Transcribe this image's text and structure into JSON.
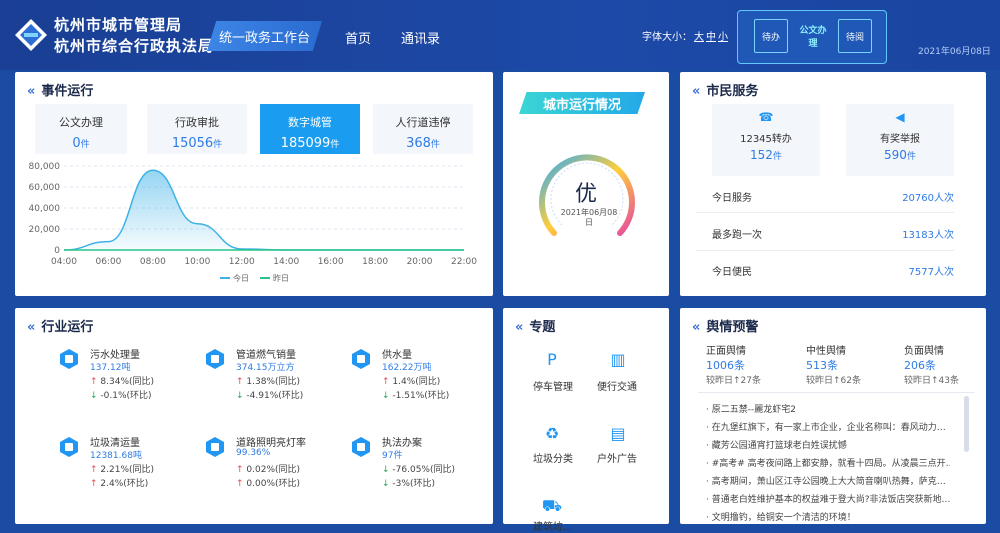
{
  "header": {
    "org_line1": "杭州市城市管理局",
    "org_line2": "杭州市综合行政执法局",
    "nav_workbench": "统一政务工作台",
    "nav_home": "首页",
    "nav_contacts": "通讯录",
    "font_label": "字体大小：",
    "font_options": [
      "大",
      "中",
      "小"
    ],
    "quick": [
      {
        "label": "待办"
      },
      {
        "label": "公文办理"
      },
      {
        "label": "待阅"
      }
    ],
    "date": "2021年06月08日"
  },
  "events": {
    "title": "事件运行",
    "stats": [
      {
        "label": "公文办理",
        "value": "0",
        "unit": "件"
      },
      {
        "label": "行政审批",
        "value": "15056",
        "unit": "件"
      },
      {
        "label": "数字城管",
        "value": "185099",
        "unit": "件"
      },
      {
        "label": "人行道违停",
        "value": "368",
        "unit": "件"
      }
    ]
  },
  "chart_data": {
    "type": "area",
    "x": [
      "04:00",
      "06:00",
      "08:00",
      "10:00",
      "12:00",
      "14:00",
      "16:00",
      "18:00",
      "20:00",
      "22:00"
    ],
    "series": [
      {
        "name": "今日",
        "values": [
          0,
          8000,
          76000,
          25000,
          1000,
          0,
          0,
          0,
          0,
          0
        ],
        "color": "#3eb2e6"
      },
      {
        "name": "昨日",
        "values": [
          0,
          0,
          0,
          0,
          0,
          0,
          0,
          0,
          0,
          0
        ],
        "color": "#27c48a"
      }
    ],
    "yticks": [
      "0",
      "20,000",
      "40,000",
      "60,000",
      "80,000"
    ],
    "ylim": [
      0,
      80000
    ],
    "grid": true,
    "legend": "bottom"
  },
  "city": {
    "title": "城市运行情况",
    "grade": "优",
    "date": "2021年06月08日"
  },
  "citizen": {
    "title": "市民服务",
    "cards": [
      {
        "label": "12345转办",
        "value": "152",
        "unit": "件"
      },
      {
        "label": "有奖举报",
        "value": "590",
        "unit": "件"
      }
    ],
    "rows": [
      {
        "label": "今日服务",
        "value": "20760人次"
      },
      {
        "label": "最多跑一次",
        "value": "13183人次"
      },
      {
        "label": "今日便民",
        "value": "7577人次"
      }
    ]
  },
  "industry": {
    "title": "行业运行",
    "items": [
      {
        "title": "污水处理量",
        "value": "137.12吨",
        "yoy": "8.34%(同比)",
        "mom": "-0.1%(环比)",
        "yoy_up": true,
        "mom_up": false
      },
      {
        "title": "管道燃气销量",
        "value": "374.15万立方",
        "yoy": "1.38%(同比)",
        "mom": "-4.91%(环比)",
        "yoy_up": true,
        "mom_up": false
      },
      {
        "title": "供水量",
        "value": "162.22万吨",
        "yoy": "1.4%(同比)",
        "mom": "-1.51%(环比)",
        "yoy_up": true,
        "mom_up": false
      },
      {
        "title": "垃圾清运量",
        "value": "12381.68吨",
        "yoy": "2.21%(同比)",
        "mom": "2.4%(环比)",
        "yoy_up": true,
        "mom_up": true
      },
      {
        "title": "道路照明亮灯率",
        "value": "99.36%",
        "yoy": "0.02%(同比)",
        "mom": "0.00%(环比)",
        "yoy_up": true,
        "mom_up": true
      },
      {
        "title": "执法办案",
        "value": "97件",
        "yoy": "-76.05%(同比)",
        "mom": "-3%(环比)",
        "yoy_up": false,
        "mom_up": false
      }
    ]
  },
  "topics": {
    "title": "专题",
    "items": [
      {
        "label": "停车管理",
        "icon": "parking-icon"
      },
      {
        "label": "便行交通",
        "icon": "traffic-icon"
      },
      {
        "label": "垃圾分类",
        "icon": "garbage-icon"
      },
      {
        "label": "户外广告",
        "icon": "billboard-icon"
      },
      {
        "label": "建筑垃...",
        "icon": "truck-icon"
      }
    ]
  },
  "opinion": {
    "title": "舆情预警",
    "cols": [
      {
        "label": "正面舆情",
        "value": "1006条",
        "cmp": "较昨日↑27条"
      },
      {
        "label": "中性舆情",
        "value": "513条",
        "cmp": "较昨日↑62条"
      },
      {
        "label": "负面舆情",
        "value": "206条",
        "cmp": "较昨日↑43条"
      }
    ],
    "news": [
      "· 原二五禁--麗龙虾宅2",
      "· 在九堡红旗下，有一家上市企业，企业名称叫：春风动力…",
      "· 藏芳公园通宵打篮球老白姓误扰憾",
      "· #高考# 高考夜间路上都安静，就看十四局。从凌晨三点开…",
      "· 高考期间，萧山区江寺公园晚上大大简音喇叭热舞，萨克…",
      "· 普通老白姓维护基本的权益难于登大尚?非法饭店突获新地…",
      "· 文明撸钓，给铜安一个清洁的环境！"
    ]
  }
}
